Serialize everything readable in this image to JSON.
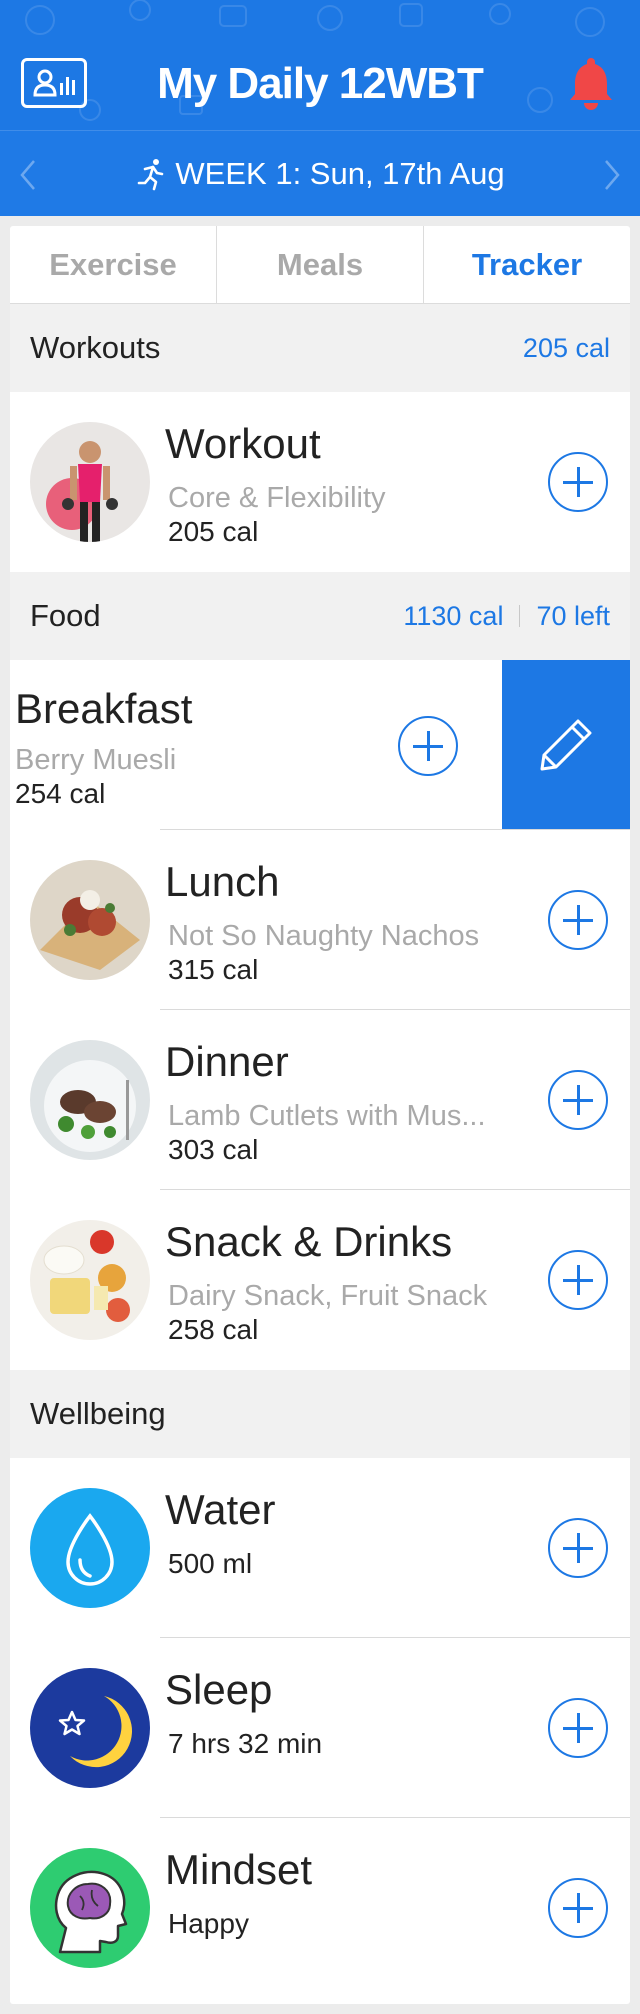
{
  "header": {
    "title": "My Daily 12WBT",
    "week_label": "WEEK 1: Sun, 17th Aug"
  },
  "tabs": [
    {
      "label": "Exercise",
      "active": false
    },
    {
      "label": "Meals",
      "active": false
    },
    {
      "label": "Tracker",
      "active": true
    }
  ],
  "workouts": {
    "title": "Workouts",
    "total": "205 cal",
    "items": [
      {
        "title": "Workout",
        "subtitle": "Core & Flexibility",
        "calories": "205 cal"
      }
    ]
  },
  "food": {
    "title": "Food",
    "total": "1130 cal",
    "left": "70 left",
    "items": [
      {
        "title": "Breakfast",
        "subtitle": "Berry Muesli",
        "calories": "254 cal"
      },
      {
        "title": "Lunch",
        "subtitle": "Not So Naughty Nachos",
        "calories": "315 cal"
      },
      {
        "title": "Dinner",
        "subtitle": "Lamb Cutlets with Mus...",
        "calories": "303 cal"
      },
      {
        "title": "Snack & Drinks",
        "subtitle": "Dairy Snack, Fruit Snack",
        "calories": "258 cal"
      }
    ]
  },
  "wellbeing": {
    "title": "Wellbeing",
    "items": [
      {
        "title": "Water",
        "value": "500 ml",
        "icon": "water-drop-icon"
      },
      {
        "title": "Sleep",
        "value": "7 hrs 32 min",
        "icon": "moon-star-icon"
      },
      {
        "title": "Mindset",
        "value": "Happy",
        "icon": "brain-head-icon"
      }
    ]
  },
  "colors": {
    "primary": "#1d78e4",
    "bell": "#f04747",
    "water": "#1aa8ef",
    "sleep": "#1c3a9e",
    "mindset": "#2ecc71"
  }
}
